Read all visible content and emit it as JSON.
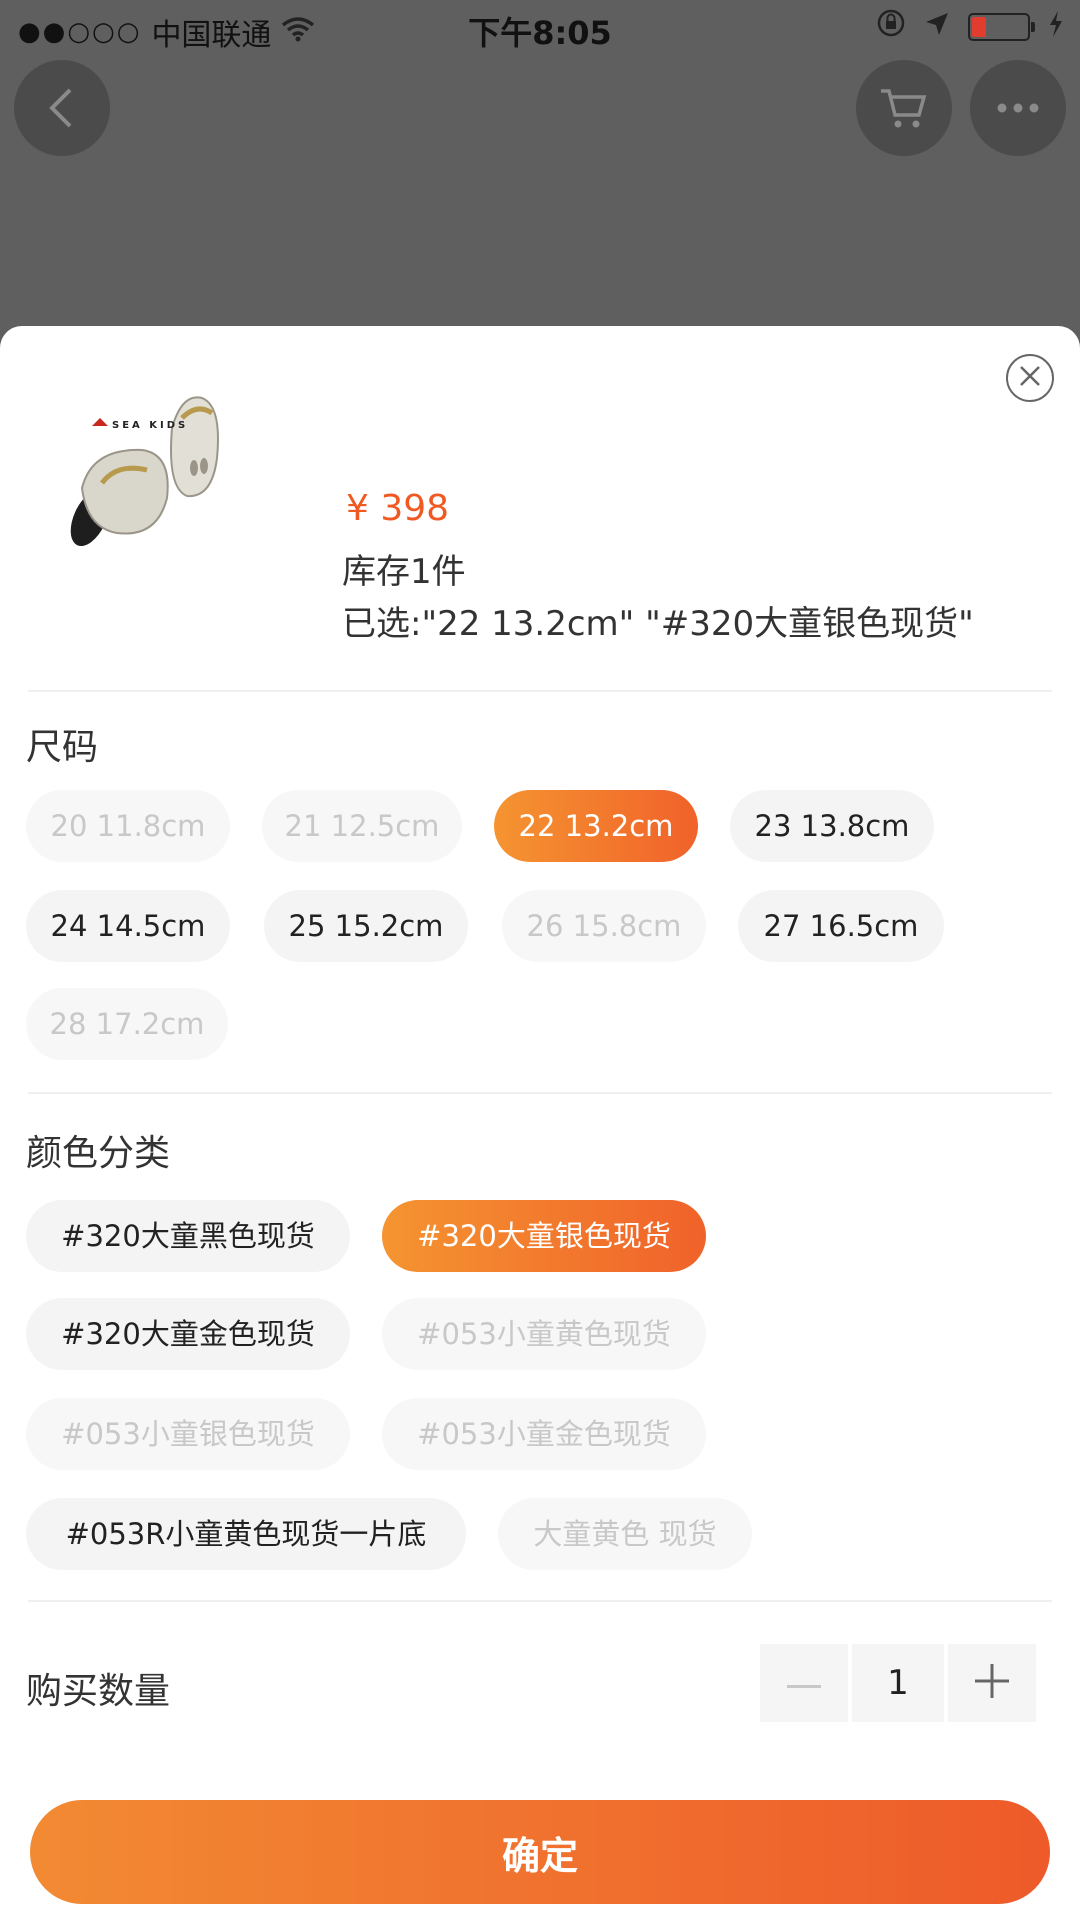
{
  "status_bar": {
    "signal_dots": "●●○○○",
    "carrier": "中国联通",
    "time": "下午8:05",
    "icons": [
      "wifi-icon",
      "orientation-lock-icon",
      "location-arrow-icon",
      "battery-icon",
      "charging-bolt-icon"
    ]
  },
  "top_bar": {
    "back_icon": "chevron-left-icon",
    "cart_icon": "cart-icon",
    "more_icon": "more-dots-icon"
  },
  "sheet": {
    "close_icon": "close-icon",
    "product_image_alt": "SEA KIDS",
    "price": "¥ 398",
    "stock": "库存1件",
    "selected": "已选:\"22 13.2cm\" \"#320大童银色现货\""
  },
  "size_section": {
    "title": "尺码",
    "options": [
      {
        "label": "20 11.8cm",
        "state": "disabled"
      },
      {
        "label": "21 12.5cm",
        "state": "disabled"
      },
      {
        "label": "22 13.2cm",
        "state": "selected"
      },
      {
        "label": "23 13.8cm",
        "state": "normal"
      },
      {
        "label": "24 14.5cm",
        "state": "normal"
      },
      {
        "label": "25 15.2cm",
        "state": "normal"
      },
      {
        "label": "26 15.8cm",
        "state": "disabled"
      },
      {
        "label": "27 16.5cm",
        "state": "normal"
      },
      {
        "label": "28 17.2cm",
        "state": "disabled"
      }
    ]
  },
  "color_section": {
    "title": "颜色分类",
    "options": [
      {
        "label": "#320大童黑色现货",
        "state": "normal"
      },
      {
        "label": "#320大童银色现货",
        "state": "selected"
      },
      {
        "label": "#320大童金色现货",
        "state": "normal"
      },
      {
        "label": "#053小童黄色现货",
        "state": "disabled"
      },
      {
        "label": "#053小童银色现货",
        "state": "disabled"
      },
      {
        "label": "#053小童金色现货",
        "state": "disabled"
      },
      {
        "label": "#053R小童黄色现货一片底",
        "state": "normal"
      },
      {
        "label": "大童黄色 现货",
        "state": "disabled"
      }
    ]
  },
  "quantity": {
    "label": "购买数量",
    "value": "1",
    "minus_icon": "minus-icon",
    "plus_icon": "plus-icon"
  },
  "confirm_label": "确定",
  "colors": {
    "accent_start": "#f59431",
    "accent_end": "#f0622a",
    "price": "#f05a22",
    "overlay": "#5f5f5f"
  }
}
